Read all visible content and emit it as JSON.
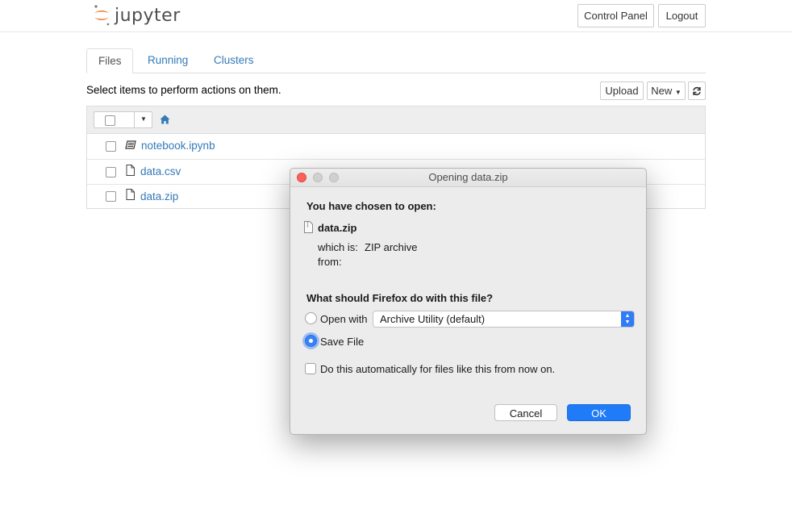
{
  "header": {
    "logo_text": "jupyter",
    "control_panel_label": "Control Panel",
    "logout_label": "Logout"
  },
  "tabs": [
    {
      "label": "Files",
      "active": true
    },
    {
      "label": "Running",
      "active": false
    },
    {
      "label": "Clusters",
      "active": false
    }
  ],
  "toolbar": {
    "hint": "Select items to perform actions on them.",
    "upload_label": "Upload",
    "new_label": "New"
  },
  "files": [
    {
      "name": "notebook.ipynb",
      "icon": "notebook-icon"
    },
    {
      "name": "data.csv",
      "icon": "file-icon"
    },
    {
      "name": "data.zip",
      "icon": "file-icon"
    }
  ],
  "dialog": {
    "title": "Opening data.zip",
    "chosen_label": "You have chosen to open:",
    "filename": "data.zip",
    "which_is_label": "which is:",
    "which_is_value": "ZIP archive",
    "from_label": "from:",
    "question": "What should Firefox do with this file?",
    "open_with_label": "Open with",
    "open_with_value": "Archive Utility (default)",
    "save_file_label": "Save File",
    "selected_option": "Save File",
    "auto_label": "Do this automatically for files like this from now on.",
    "auto_checked": false,
    "cancel_label": "Cancel",
    "ok_label": "OK"
  },
  "colors": {
    "link": "#337ab7",
    "ok_button": "#1f7bf7",
    "radio_selected": "#3b82f6"
  }
}
